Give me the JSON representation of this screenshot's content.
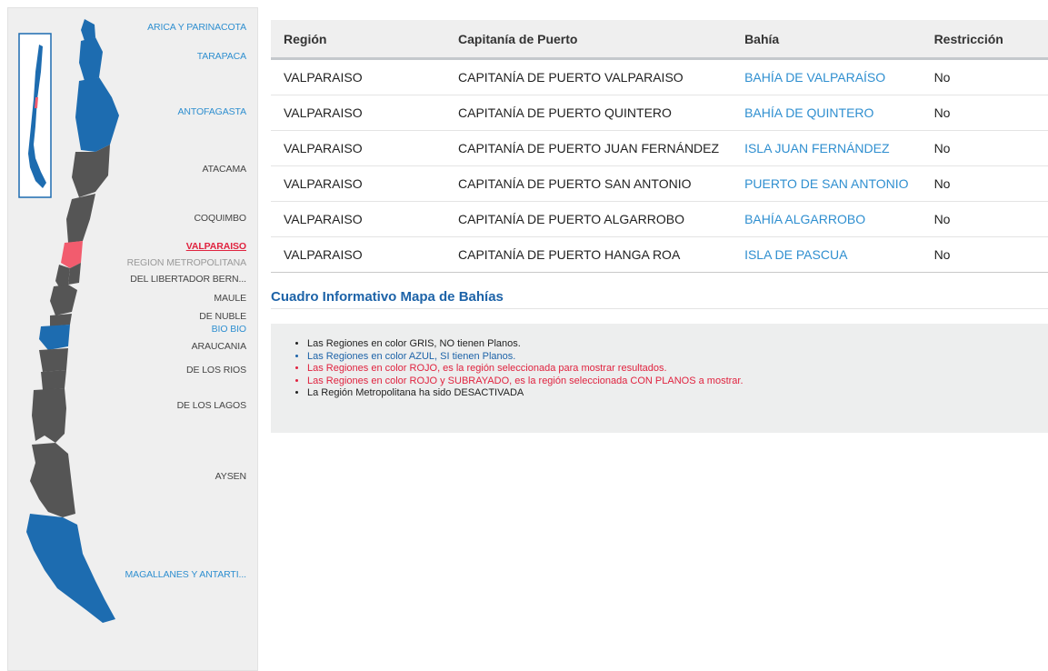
{
  "colors": {
    "region_grey": "#555555",
    "region_blue": "#1d6cb0",
    "region_selected": "#f25c6e",
    "link_blue": "#2f8fd0",
    "heading_blue": "#1d63a8",
    "alert_red": "#e0233f"
  },
  "map": {
    "regions": [
      {
        "label": "ARICA Y PARINACOTA",
        "status": "blue"
      },
      {
        "label": "TARAPACA",
        "status": "blue"
      },
      {
        "label": "ANTOFAGASTA",
        "status": "blue"
      },
      {
        "label": "ATACAMA",
        "status": "grey"
      },
      {
        "label": "COQUIMBO",
        "status": "grey"
      },
      {
        "label": "VALPARAISO",
        "status": "selected"
      },
      {
        "label": "REGION METROPOLITANA",
        "status": "disabled"
      },
      {
        "label": "DEL LIBERTADOR BERN...",
        "status": "grey"
      },
      {
        "label": "MAULE",
        "status": "grey"
      },
      {
        "label": "DE NUBLE",
        "status": "grey"
      },
      {
        "label": "BIO BIO",
        "status": "blue"
      },
      {
        "label": "ARAUCANIA",
        "status": "grey"
      },
      {
        "label": "DE LOS RIOS",
        "status": "grey"
      },
      {
        "label": "DE LOS LAGOS",
        "status": "grey"
      },
      {
        "label": "AYSEN",
        "status": "grey"
      },
      {
        "label": "MAGALLANES Y ANTARTI...",
        "status": "blue"
      }
    ]
  },
  "table": {
    "headers": [
      "Región",
      "Capitanía de Puerto",
      "Bahía",
      "Restricción"
    ],
    "rows": [
      [
        "VALPARAISO",
        "CAPITANÍA DE PUERTO VALPARAISO",
        "BAHÍA DE VALPARAÍSO",
        "No"
      ],
      [
        "VALPARAISO",
        "CAPITANÍA DE PUERTO QUINTERO",
        "BAHÍA DE QUINTERO",
        "No"
      ],
      [
        "VALPARAISO",
        "CAPITANÍA DE PUERTO JUAN FERNÁNDEZ",
        "ISLA JUAN FERNÁNDEZ",
        "No"
      ],
      [
        "VALPARAISO",
        "CAPITANÍA DE PUERTO SAN ANTONIO",
        "PUERTO DE SAN ANTONIO",
        "No"
      ],
      [
        "VALPARAISO",
        "CAPITANÍA DE PUERTO ALGARROBO",
        "BAHÍA ALGARROBO",
        "No"
      ],
      [
        "VALPARAISO",
        "CAPITANÍA DE PUERTO HANGA ROA",
        "ISLA DE PASCUA",
        "No"
      ]
    ]
  },
  "info": {
    "title": "Cuadro Informativo Mapa de Bahías",
    "items": [
      {
        "text": "Las Regiones en color GRIS, NO tienen Planos.",
        "color": "default"
      },
      {
        "text": "Las Regiones en color AZUL, SI tienen Planos.",
        "color": "blue"
      },
      {
        "text": "Las Regiones en color ROJO, es la región seleccionada para mostrar resultados.",
        "color": "red"
      },
      {
        "text": "Las Regiones en color ROJO y SUBRAYADO, es la región seleccionada CON PLANOS a mostrar.",
        "color": "red"
      },
      {
        "text": "La Región Metropolitana ha sido DESACTIVADA",
        "color": "default"
      }
    ]
  }
}
